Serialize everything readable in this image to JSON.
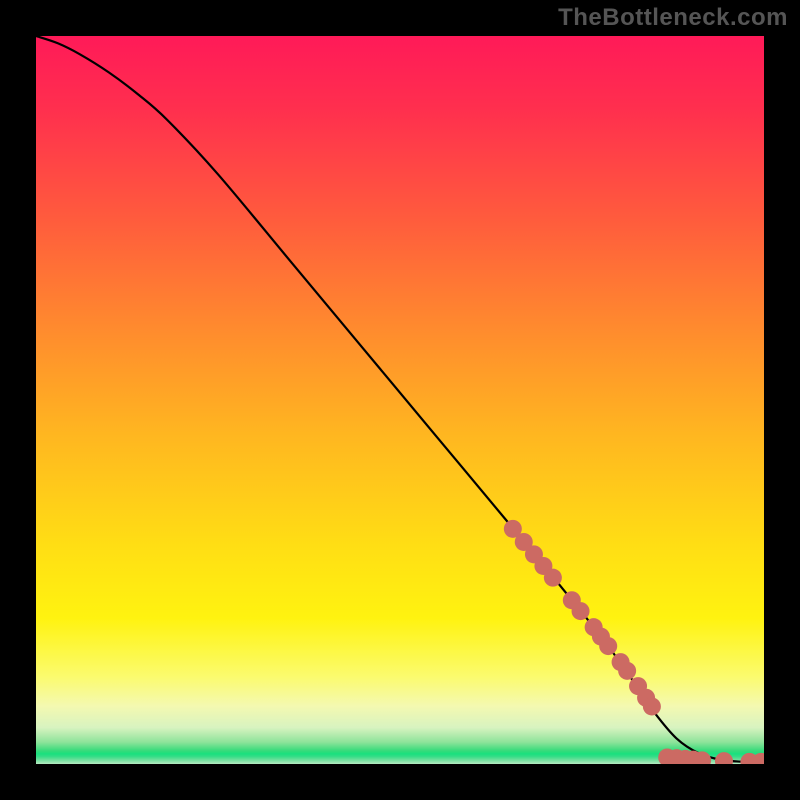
{
  "attribution": "TheBottleneck.com",
  "chart_data": {
    "type": "line",
    "title": "",
    "xlabel": "",
    "ylabel": "",
    "xlim": [
      0,
      100
    ],
    "ylim": [
      0,
      100
    ],
    "series": [
      {
        "name": "curve",
        "x": [
          0,
          3,
          6,
          10,
          14,
          18,
          25,
          35,
          45,
          55,
          65,
          72,
          78,
          83,
          85,
          88,
          91,
          94,
          97,
          100
        ],
        "y": [
          100,
          99,
          97.5,
          95,
          92,
          88.5,
          81,
          69,
          57,
          45,
          33,
          24.5,
          17,
          10,
          7,
          3.5,
          1.5,
          0.6,
          0.3,
          0.2
        ]
      }
    ],
    "markers": [
      {
        "name": "dots",
        "color": "#cc6a63",
        "radius": 9,
        "points": [
          {
            "x": 65.5,
            "y": 32.3
          },
          {
            "x": 67.0,
            "y": 30.5
          },
          {
            "x": 68.4,
            "y": 28.8
          },
          {
            "x": 69.7,
            "y": 27.2
          },
          {
            "x": 71.0,
            "y": 25.6
          },
          {
            "x": 73.6,
            "y": 22.5
          },
          {
            "x": 74.8,
            "y": 21.0
          },
          {
            "x": 76.6,
            "y": 18.8
          },
          {
            "x": 77.6,
            "y": 17.5
          },
          {
            "x": 78.6,
            "y": 16.2
          },
          {
            "x": 80.3,
            "y": 14.0
          },
          {
            "x": 81.2,
            "y": 12.8
          },
          {
            "x": 82.7,
            "y": 10.7
          },
          {
            "x": 83.8,
            "y": 9.1
          },
          {
            "x": 84.6,
            "y": 7.9
          },
          {
            "x": 86.7,
            "y": 0.9
          },
          {
            "x": 88.0,
            "y": 0.8
          },
          {
            "x": 89.2,
            "y": 0.7
          },
          {
            "x": 90.3,
            "y": 0.6
          },
          {
            "x": 91.5,
            "y": 0.5
          },
          {
            "x": 94.5,
            "y": 0.4
          },
          {
            "x": 98.0,
            "y": 0.3
          },
          {
            "x": 99.6,
            "y": 0.3
          }
        ]
      }
    ]
  }
}
